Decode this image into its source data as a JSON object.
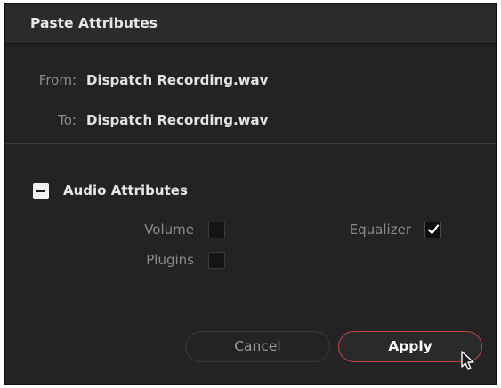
{
  "dialog": {
    "title": "Paste Attributes"
  },
  "source": {
    "from_label": "From:",
    "from_value": "Dispatch Recording.wav",
    "to_label": "To:",
    "to_value": "Dispatch Recording.wav"
  },
  "section": {
    "title": "Audio Attributes",
    "expanded": true,
    "toggle_icon": "minus-icon",
    "options": [
      {
        "label": "Volume",
        "checked": false
      },
      {
        "label": "Equalizer",
        "checked": true
      },
      {
        "label": "Plugins",
        "checked": false
      }
    ]
  },
  "buttons": {
    "cancel_label": "Cancel",
    "apply_label": "Apply"
  },
  "colors": {
    "dialog_background": "#232326",
    "accent_border": "#c0463a"
  }
}
